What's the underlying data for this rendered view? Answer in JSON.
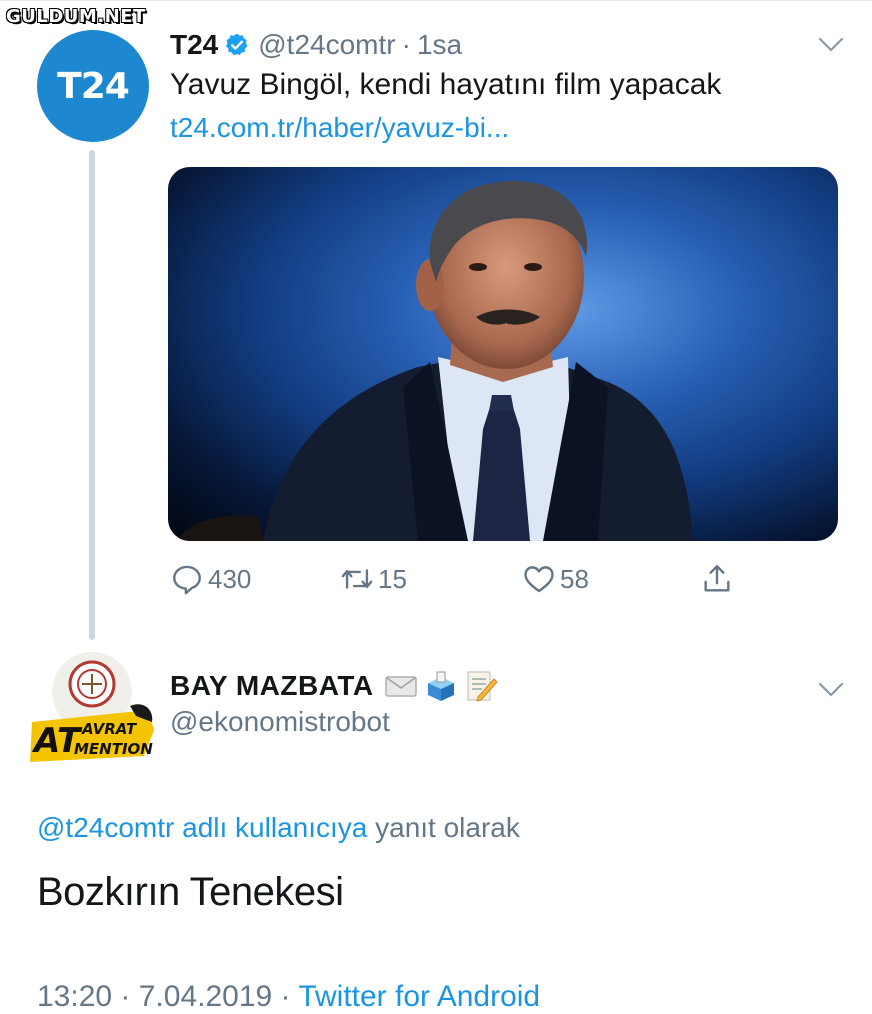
{
  "watermark": "GULDUM.NET",
  "tweet1": {
    "avatar_text": "T24",
    "name": "T24",
    "handle": "@t24comtr",
    "separator": "·",
    "time": "1sa",
    "text": "Yavuz Bingöl, kendi hayatını film yapacak",
    "link": "t24.com.tr/haber/yavuz-bi...",
    "actions": {
      "replies": "430",
      "retweets": "15",
      "likes": "58"
    },
    "icons": [
      "verified-badge-icon",
      "chevron-down-icon",
      "reply-icon",
      "retweet-icon",
      "like-icon",
      "share-icon"
    ]
  },
  "tweet2": {
    "name": "BAY MAZBATA",
    "name_emojis": [
      "envelope-icon",
      "ballot-box-icon",
      "memo-icon"
    ],
    "handle": "@ekonomistrobot",
    "avatar_text": [
      "AVRAT",
      "AT",
      "MENTION"
    ],
    "reply_to_handle": "@t24comtr adlı kullanıcıya",
    "reply_to_rest": "yanıt olarak",
    "text": "Bozkırın Tenekesi",
    "time": "13:20 · 7.04.2019 ·",
    "source": "Twitter for Android"
  },
  "colors": {
    "link": "#1b95e0",
    "secondary_text": "#657786",
    "t24_blue": "#1d88d0",
    "thread_line": "#ccd6dd"
  }
}
